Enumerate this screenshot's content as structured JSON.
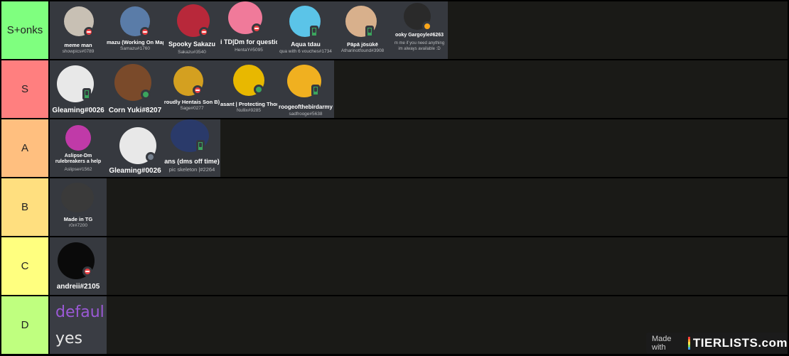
{
  "tiers": [
    {
      "label": "S+onks",
      "color": "#7fff7f"
    },
    {
      "label": "S",
      "color": "#ff7f7f"
    },
    {
      "label": "A",
      "color": "#ffbf7f"
    },
    {
      "label": "B",
      "color": "#ffdf7f"
    },
    {
      "label": "C",
      "color": "#ffff7f"
    },
    {
      "label": "D",
      "color": "#bfff7f"
    }
  ],
  "items": {
    "splus": [
      {
        "name": "meme man",
        "sub": "showpics#0789",
        "status": "dnd",
        "avatar_color": "#c8c0b4"
      },
      {
        "name": "mazu (Working On Map",
        "sub": "Samazu#1760",
        "status": "dnd",
        "avatar_color": "#5a7ca8"
      },
      {
        "name": "Spooky Sakazu",
        "sub": "Sakazu#3540",
        "status": "dnd",
        "avatar_color": "#b8283a"
      },
      {
        "name": "i TD|Dm for questio",
        "sub": "HentaY#5095",
        "status": "dnd",
        "avatar_color": "#f07a9a"
      },
      {
        "name": "Aqua tdau",
        "sub": "qua with 6 vouches#1734",
        "status": "mobile",
        "avatar_color": "#5bc4e8"
      },
      {
        "name": "Pāpā jösükē",
        "sub": "Atharinotfound#3908",
        "status": "mobile",
        "avatar_color": "#d8b08c"
      },
      {
        "name": "ooky Gargoyle#6263",
        "sub": "m me if you need anything im always available :D",
        "status": "idle",
        "avatar_color": "#2a2a2a"
      }
    ],
    "s": [
      {
        "name": "Gleaming#0026",
        "sub": "",
        "status": "mobile",
        "avatar_color": "#e8e8e8"
      },
      {
        "name": "Corn Yuki#8207",
        "sub": "",
        "status": "online",
        "avatar_color": "#7a4a2a"
      },
      {
        "name": "roudly Hentais Son B)",
        "sub": "Sage#0277",
        "status": "dnd",
        "avatar_color": "#d4a020"
      },
      {
        "name": "asant | Protecting Thor",
        "sub": "Nullix#9285",
        "status": "online",
        "avatar_color": "#e8b800"
      },
      {
        "name": "roogeofthebirdarmy",
        "sub": "sadfrooge#5638",
        "status": "mobile",
        "avatar_color": "#f0b020"
      }
    ],
    "a": [
      {
        "name": "Aslipse-Dm rulebreakers a help",
        "sub": "Aslipse#1562",
        "status": "none",
        "avatar_color": "#c03aa8"
      },
      {
        "name": "Gleaming#0026",
        "sub": "",
        "status": "offline",
        "avatar_color": "#e8e8e8"
      },
      {
        "name": "ans (dms off time)",
        "sub": "pic skeleton |#2264",
        "status": "mobile",
        "avatar_color": "#2a3a6a"
      }
    ],
    "b": [
      {
        "name": "Made in TG",
        "sub": "r0r#7200",
        "status": "none",
        "avatar_color": "#3a3a3a"
      }
    ],
    "c": [
      {
        "name": "andreii#2105",
        "sub": "",
        "status": "dnd",
        "avatar_color": "#0a0a0a"
      }
    ],
    "d": [
      {
        "line1": "defaul",
        "line2": "yes"
      }
    ]
  },
  "watermark": {
    "made_with": "Made with",
    "brand": "TIERLISTS.com"
  }
}
